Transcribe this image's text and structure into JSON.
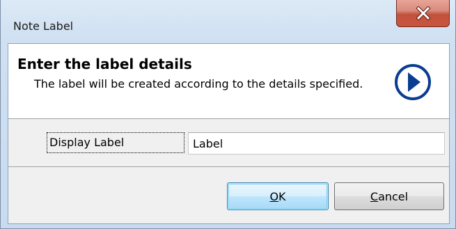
{
  "window": {
    "title": "Note Label",
    "close_icon": "close-x-icon"
  },
  "header": {
    "title": "Enter the label details",
    "description": "The label will be created according to the details specified.",
    "icon": "next-arrow-icon"
  },
  "field": {
    "label": "Display Label",
    "value": "Label"
  },
  "buttons": {
    "ok": {
      "mnemonic": "O",
      "rest": "K"
    },
    "cancel": {
      "mnemonic": "C",
      "rest": "ancel"
    }
  },
  "colors": {
    "close_button": "#c8553f",
    "icon_blue": "#0a3d91",
    "accent_focus": "#3c7fb1"
  }
}
